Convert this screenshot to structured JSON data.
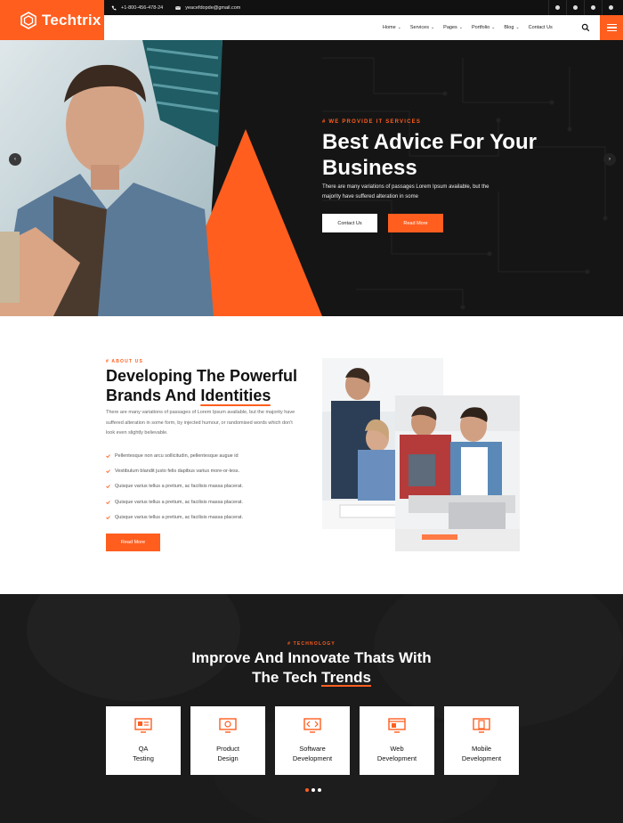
{
  "brand": {
    "name": "Techtrix",
    "accent": "#ff5e1f"
  },
  "topbar": {
    "phone": "+1-800-456-478-24",
    "email": "yeacefdopde@gmail.com",
    "socials": [
      "facebook-icon",
      "github-icon",
      "instagram-icon",
      "skype-icon"
    ]
  },
  "nav": {
    "items": [
      {
        "label": "Home",
        "chevron": "⌄"
      },
      {
        "label": "Services",
        "chevron": "⌄"
      },
      {
        "label": "Pages",
        "chevron": "⌄"
      },
      {
        "label": "Portfolio",
        "chevron": "⌄"
      },
      {
        "label": "Blog",
        "chevron": "⌄"
      },
      {
        "label": "Contact Us",
        "chevron": ""
      }
    ]
  },
  "hero": {
    "subtitle": "# WE PROVIDE IT SERVICES",
    "title": "Best Advice For Your Business",
    "description": "There are many variations of passages Lorem Ipsum available, but the majority have suffered alteration in some",
    "btn_contact": "Contact Us",
    "btn_read": "Read More",
    "arrow_prev": "‹",
    "arrow_next": "›"
  },
  "about": {
    "subtitle": "# ABOUT US",
    "title_line1": "Developing The Powerful",
    "title_line2_pre": "Brands And ",
    "title_line2_ul": "Identities",
    "description": "There are many variations of passages of Lorem Ipsum available, but the majority have suffered alteration in some form, by injected humour, or randomised words which don't look even slightly believable.",
    "list": [
      "Pellentesque non arcu sollicitudin, pellentesque augue id",
      "Vestibulum blandit justo felis dapibus varius more-or-less.",
      "Quisque varius tellus a pretium, ac facilisis massa placerat.",
      "Quisque varius tellus a pretium, ac facilisis massa placerat.",
      "Quisque varius tellus a pretium, ac facilisis massa placerat."
    ],
    "button": "Read More"
  },
  "tech": {
    "subtitle": "# TECHNOLOGY",
    "title_line1": "Improve And Innovate Thats With",
    "title_line2_pre": "The Tech ",
    "title_line2_ul": "Trends",
    "cards": [
      {
        "line1": "QA",
        "line2": "Testing"
      },
      {
        "line1": "Product",
        "line2": "Design"
      },
      {
        "line1": "Software",
        "line2": "Development"
      },
      {
        "line1": "Web",
        "line2": "Development"
      },
      {
        "line1": "Mobile",
        "line2": "Development"
      }
    ],
    "pager": {
      "current": 1,
      "total": 3
    }
  }
}
